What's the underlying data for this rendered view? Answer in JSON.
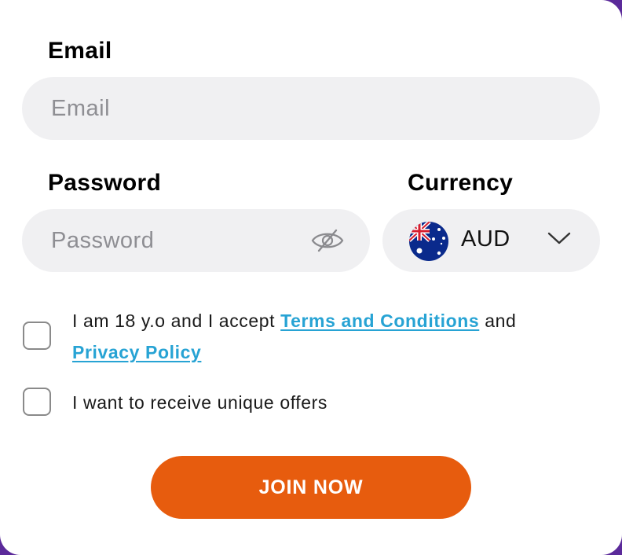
{
  "email": {
    "label": "Email",
    "placeholder": "Email"
  },
  "password": {
    "label": "Password",
    "placeholder": "Password",
    "toggle_icon": "eye-slash-icon"
  },
  "currency": {
    "label": "Currency",
    "selected": "AUD",
    "flag_icon": "australia-flag-icon",
    "dropdown_icon": "chevron-down-icon"
  },
  "consent": {
    "age_text_prefix": "I am 18 y.o and I accept ",
    "terms_link": "Terms and Conditions",
    "age_text_middle": " and",
    "privacy_link": "Privacy Policy",
    "offers_text": "I want to receive unique offers"
  },
  "cta": {
    "join_label": "JOIN NOW"
  },
  "colors": {
    "accent": "#e75c0e",
    "link": "#27a3d4",
    "field_bg": "#f0f0f2",
    "frame": "#5b2a9a"
  }
}
